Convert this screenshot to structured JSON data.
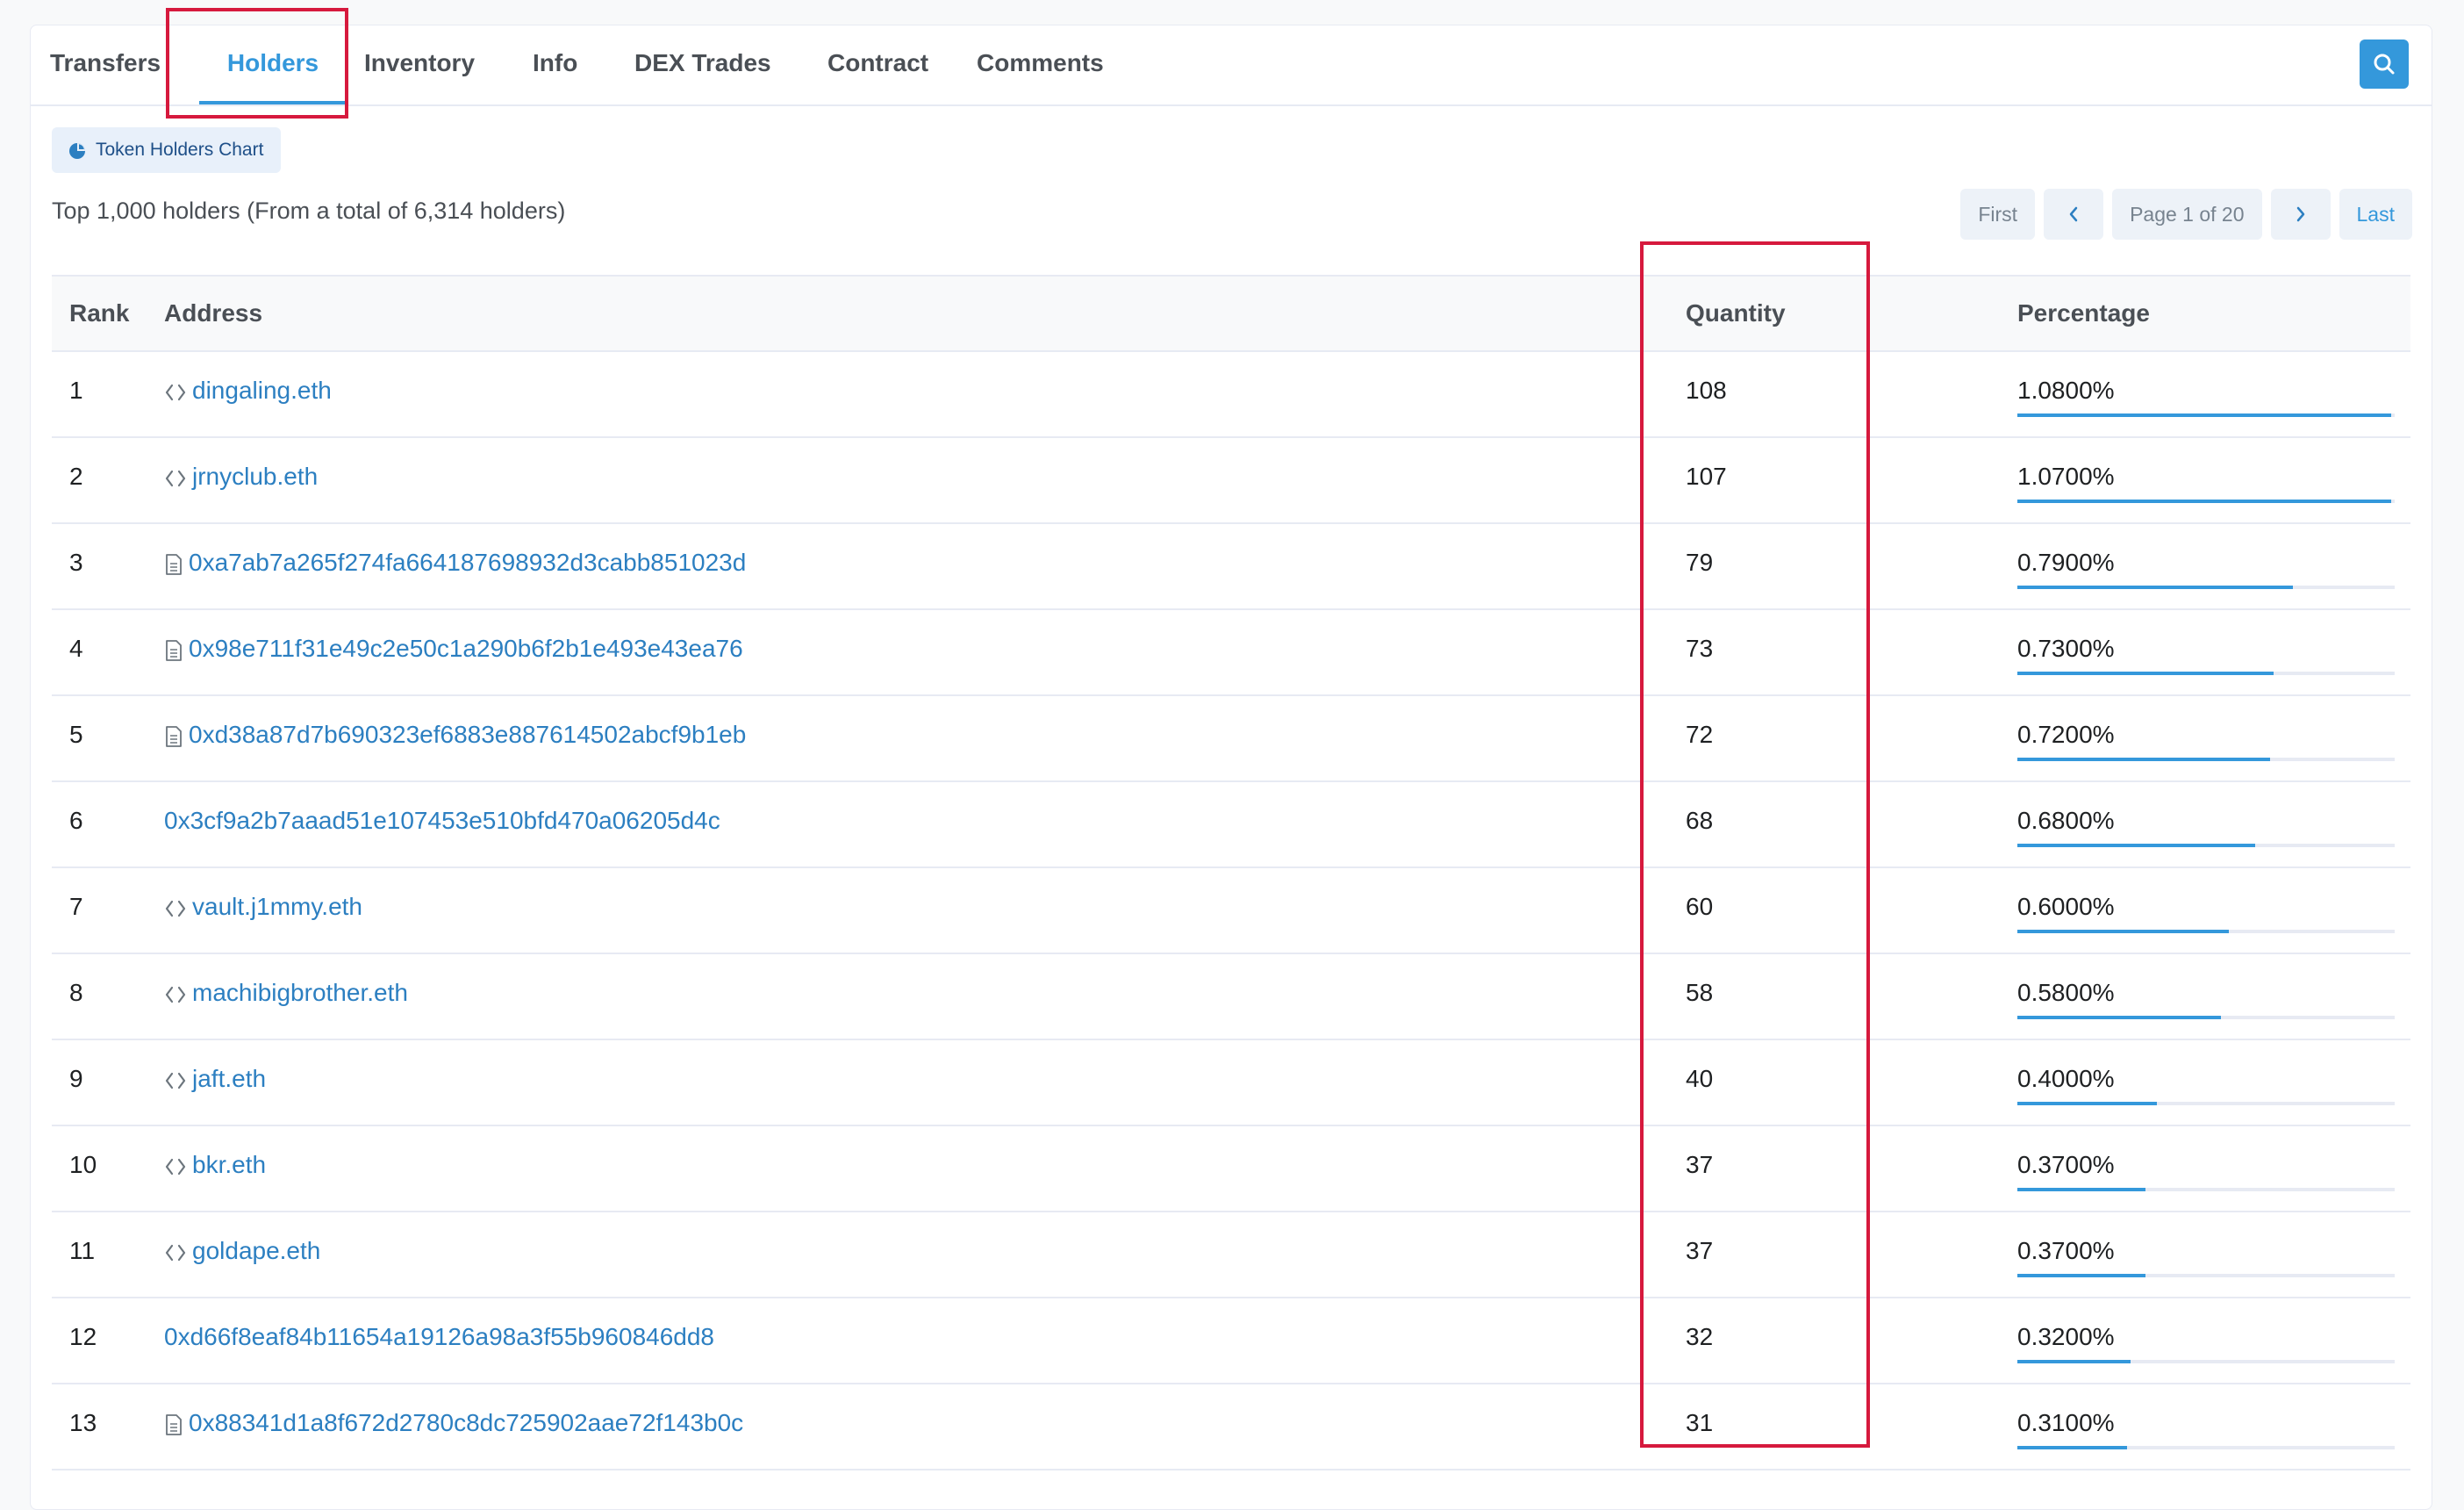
{
  "tabs": [
    {
      "label": "Transfers"
    },
    {
      "label": "Holders"
    },
    {
      "label": "Inventory"
    },
    {
      "label": "Info"
    },
    {
      "label": "DEX Trades"
    },
    {
      "label": "Contract"
    },
    {
      "label": "Comments"
    }
  ],
  "active_tab": "Holders",
  "chart_button_label": "Token Holders Chart",
  "summary_text": "Top 1,000 holders (From a total of 6,314 holders)",
  "pagination": {
    "first": "First",
    "page_label": "Page 1 of 20",
    "last": "Last"
  },
  "table": {
    "columns": {
      "rank": "Rank",
      "address": "Address",
      "quantity": "Quantity",
      "percentage": "Percentage"
    },
    "rows": [
      {
        "rank": "1",
        "address": "dingaling.eth",
        "icon": "code-icon",
        "quantity": "108",
        "percentage": "1.0800%",
        "level": 0.99
      },
      {
        "rank": "2",
        "address": "jrnyclub.eth",
        "icon": "code-icon",
        "quantity": "107",
        "percentage": "1.0700%",
        "level": 0.99
      },
      {
        "rank": "3",
        "address": "0xa7ab7a265f274fa664187698932d3cabb851023d",
        "icon": "document-icon",
        "quantity": "79",
        "percentage": "0.7900%",
        "level": 0.73
      },
      {
        "rank": "4",
        "address": "0x98e711f31e49c2e50c1a290b6f2b1e493e43ea76",
        "icon": "document-icon",
        "quantity": "73",
        "percentage": "0.7300%",
        "level": 0.68
      },
      {
        "rank": "5",
        "address": "0xd38a87d7b690323ef6883e887614502abcf9b1eb",
        "icon": "document-icon",
        "quantity": "72",
        "percentage": "0.7200%",
        "level": 0.67
      },
      {
        "rank": "6",
        "address": "0x3cf9a2b7aaad51e107453e510bfd470a06205d4c",
        "icon": "",
        "quantity": "68",
        "percentage": "0.6800%",
        "level": 0.63
      },
      {
        "rank": "7",
        "address": "vault.j1mmy.eth",
        "icon": "code-icon",
        "quantity": "60",
        "percentage": "0.6000%",
        "level": 0.56
      },
      {
        "rank": "8",
        "address": "machibigbrother.eth",
        "icon": "code-icon",
        "quantity": "58",
        "percentage": "0.5800%",
        "level": 0.54
      },
      {
        "rank": "9",
        "address": "jaft.eth",
        "icon": "code-icon",
        "quantity": "40",
        "percentage": "0.4000%",
        "level": 0.37
      },
      {
        "rank": "10",
        "address": "bkr.eth",
        "icon": "code-icon",
        "quantity": "37",
        "percentage": "0.3700%",
        "level": 0.34
      },
      {
        "rank": "11",
        "address": "goldape.eth",
        "icon": "code-icon",
        "quantity": "37",
        "percentage": "0.3700%",
        "level": 0.34
      },
      {
        "rank": "12",
        "address": "0xd66f8eaf84b11654a19126a98a3f55b960846dd8",
        "icon": "",
        "quantity": "32",
        "percentage": "0.3200%",
        "level": 0.3
      },
      {
        "rank": "13",
        "address": "0x88341d1a8f672d2780c8dc725902aae72f143b0c",
        "icon": "document-icon",
        "quantity": "31",
        "percentage": "0.3100%",
        "level": 0.29
      }
    ]
  },
  "colors": {
    "accent": "#3498db",
    "link": "#2c7fc1",
    "highlight": "#d6193d"
  }
}
